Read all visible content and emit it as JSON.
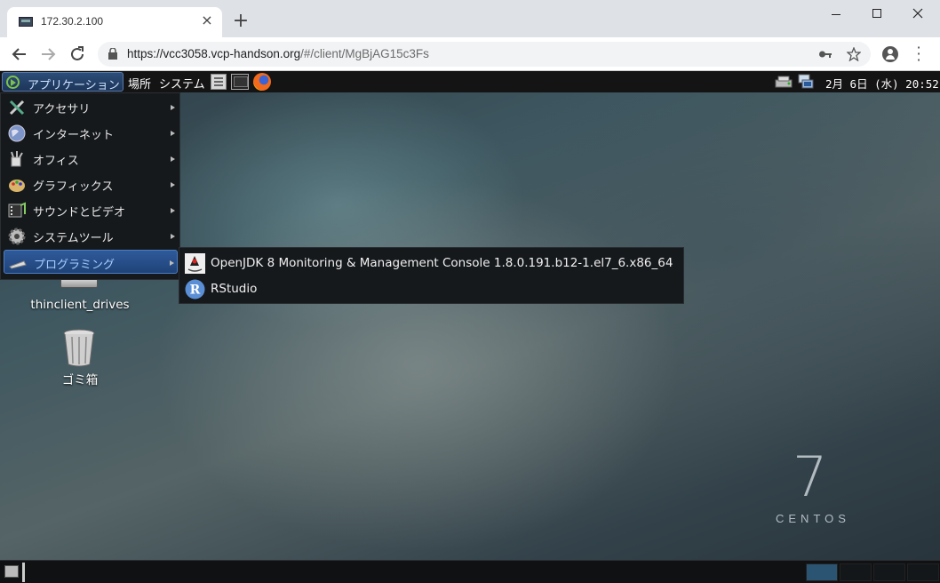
{
  "browser": {
    "tab_title": "172.30.2.100",
    "tab_close": "×",
    "new_tab": "+",
    "url_host": "https://vcc3058.vcp-handson.org",
    "url_path": "/#/client/MgBjAG15c3Fs"
  },
  "panel": {
    "applications": "アプリケーション",
    "places": "場所",
    "system": "システム",
    "clock": "2月 6日 (水) 20:52"
  },
  "apps_menu": {
    "items": [
      {
        "label": "アクセサリ",
        "icon": "accessories-icon"
      },
      {
        "label": "インターネット",
        "icon": "internet-icon"
      },
      {
        "label": "オフィス",
        "icon": "office-icon"
      },
      {
        "label": "グラフィックス",
        "icon": "graphics-icon"
      },
      {
        "label": "サウンドとビデオ",
        "icon": "sound-video-icon"
      },
      {
        "label": "システムツール",
        "icon": "system-tools-icon"
      },
      {
        "label": "プログラミング",
        "icon": "programming-icon",
        "active": true
      }
    ]
  },
  "programming_submenu": {
    "items": [
      {
        "label": "OpenJDK 8 Monitoring & Management Console 1.8.0.191.b12-1.el7_6.x86_64",
        "icon": "java-duke-icon"
      },
      {
        "label": "RStudio",
        "icon": "rstudio-icon"
      }
    ]
  },
  "desktop_icons": {
    "drives": "thinclient_drives",
    "trash": "ゴミ箱"
  },
  "branding": {
    "number": "7",
    "word": "CENTOS"
  },
  "colors": {
    "menu_bg": "#16191c",
    "active_item": "#2f5a9a",
    "panel_bg": "#141414"
  }
}
